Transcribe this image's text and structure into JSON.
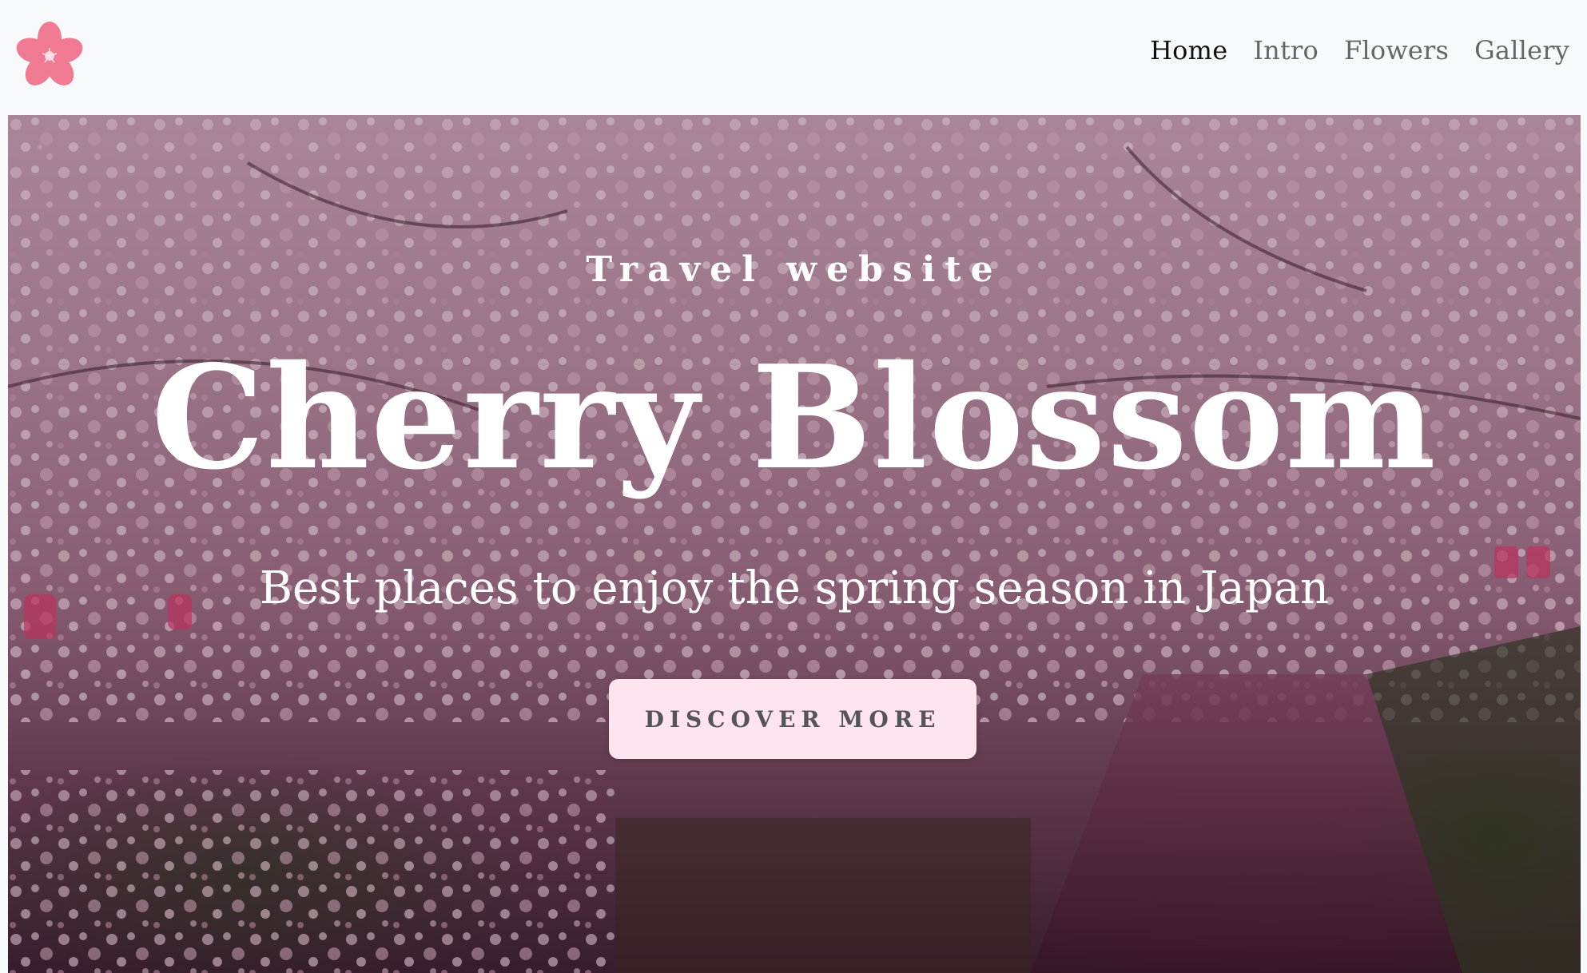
{
  "nav": {
    "logo_icon": "cherry-blossom-icon",
    "brand_color": "#f07a92",
    "links": [
      {
        "label": "Home",
        "active": true
      },
      {
        "label": "Intro",
        "active": false
      },
      {
        "label": "Flowers",
        "active": false
      },
      {
        "label": "Gallery",
        "active": false
      }
    ]
  },
  "hero": {
    "background": "cherry-blossom-canal-photo",
    "eyebrow": "Travel website",
    "title": "Cherry Blossom",
    "subtitle": "Best places to enjoy the spring season in Japan",
    "cta_label": "DISCOVER MORE",
    "cta_color": "#fde4ee"
  }
}
